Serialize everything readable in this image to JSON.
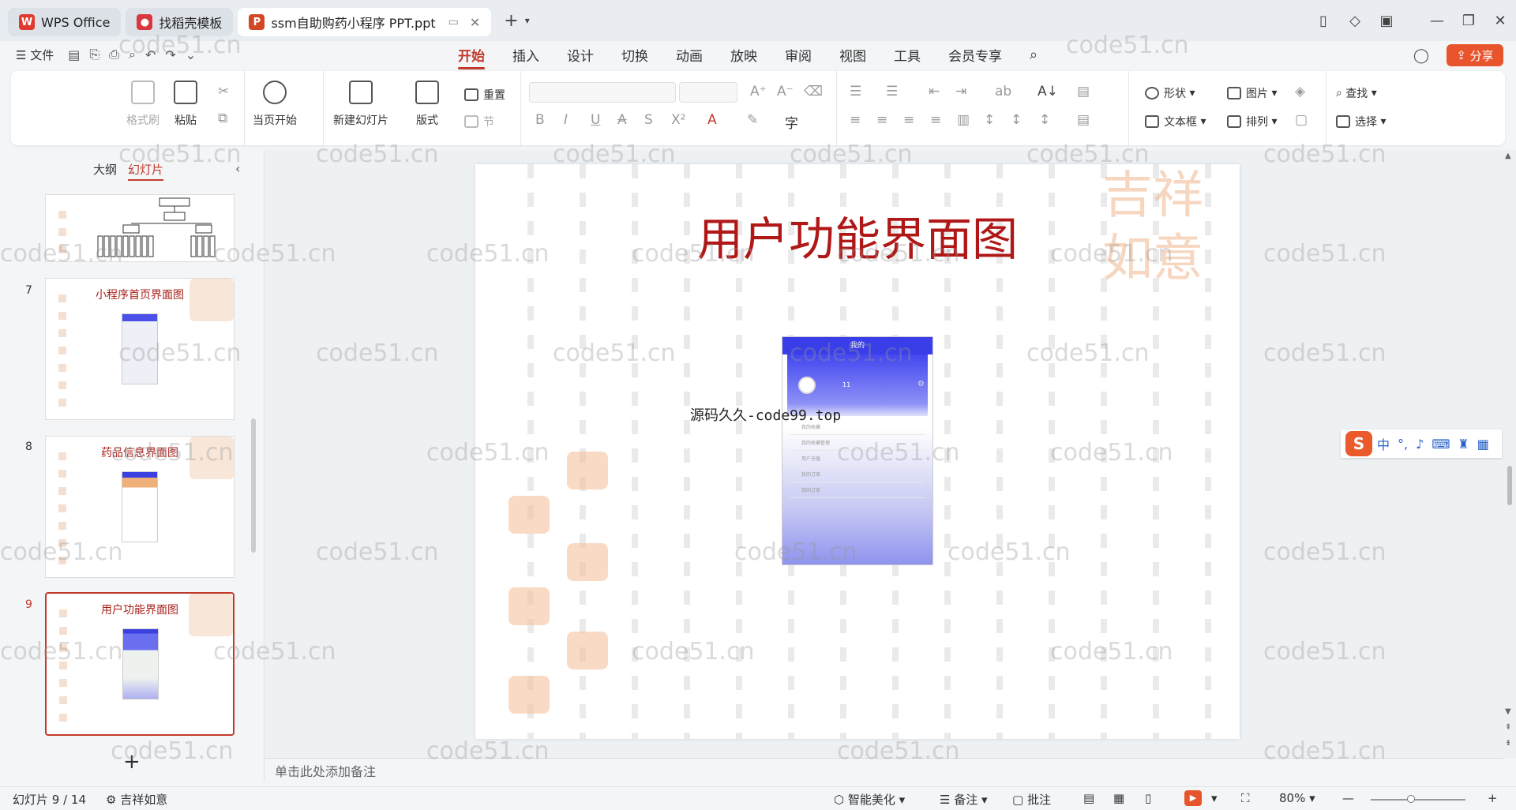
{
  "titlebar": {
    "tabs": [
      {
        "label": "WPS Office",
        "active": false,
        "color": "#e03a2e"
      },
      {
        "label": "找稻壳模板",
        "active": false,
        "color": "#d9363e"
      },
      {
        "label": "ssm自助购药小程序 PPT.ppt",
        "active": true,
        "color": "#d24726"
      }
    ]
  },
  "menubar": {
    "file": "文件",
    "items": [
      "开始",
      "插入",
      "设计",
      "切换",
      "动画",
      "放映",
      "审阅",
      "视图",
      "工具",
      "会员专享"
    ],
    "active": "开始",
    "share": "分享"
  },
  "ribbon": {
    "format_painter": "格式刷",
    "paste": "粘贴",
    "play_from_current": "当页开始",
    "new_slide": "新建幻灯片",
    "layout": "版式",
    "reset": "重置",
    "section": "节",
    "shape": "形状",
    "picture": "图片",
    "find": "查找",
    "textbox": "文本框",
    "arrange": "排列",
    "select": "选择"
  },
  "panel": {
    "tab_outline": "大纲",
    "tab_slides": "幻灯片",
    "thumbs": [
      {
        "num": "7",
        "title": "小程序首页界面图"
      },
      {
        "num": "8",
        "title": "药品信息界面图"
      },
      {
        "num": "9",
        "title": "用户功能界面图"
      }
    ]
  },
  "slide": {
    "title": "用户功能界面图",
    "caption": "源码久久-code99.top",
    "phone": {
      "header": "我的",
      "username": "11",
      "rows": [
        "我的收藏",
        "我的收藏管理",
        "用户充值",
        "我的订单",
        "我的订单"
      ]
    }
  },
  "notes_placeholder": "单击此处添加备注",
  "status": {
    "slide_counter": "幻灯片 9 / 14",
    "theme": "吉祥如意",
    "beautify": "智能美化",
    "notes": "备注",
    "comments": "批注",
    "zoom": "80%"
  },
  "watermark": "code51.cn",
  "colors": {
    "accent": "#c0392b",
    "share": "#e8552d",
    "title_red": "#b01818"
  }
}
